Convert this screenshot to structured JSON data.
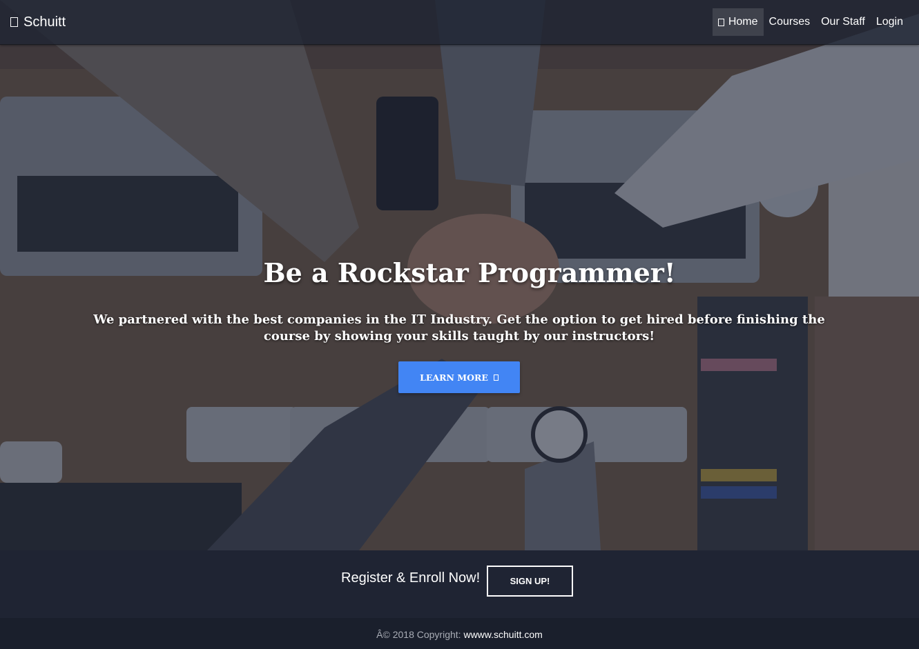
{
  "navbar": {
    "brand": "Schuitt",
    "brand_icon": "graduation-cap-icon",
    "items": [
      {
        "label": "Home",
        "icon": "home-icon",
        "active": true
      },
      {
        "label": "Courses"
      },
      {
        "label": "Our Staff"
      },
      {
        "label": "Login"
      }
    ]
  },
  "hero": {
    "title": "Be a Rockstar Programmer!",
    "subtitle": "We partnered with the best companies in the IT Industry. Get the option to get hired before finishing the course by showing your skills taught by our instructors!",
    "button_label": "LEARN MORE",
    "button_icon": "arrow-right-icon"
  },
  "cta": {
    "text": "Register & Enroll Now!",
    "button_label": "SIGN UP!"
  },
  "footer": {
    "prefix": "Â© 2018 Copyright:",
    "link_text": "wwww.schuitt.com"
  },
  "colors": {
    "accent_button": "#4285f4",
    "navbar_bg": "#1e2432",
    "cta_bg": "#1f2433",
    "footer_bg": "#1a1f2c"
  }
}
